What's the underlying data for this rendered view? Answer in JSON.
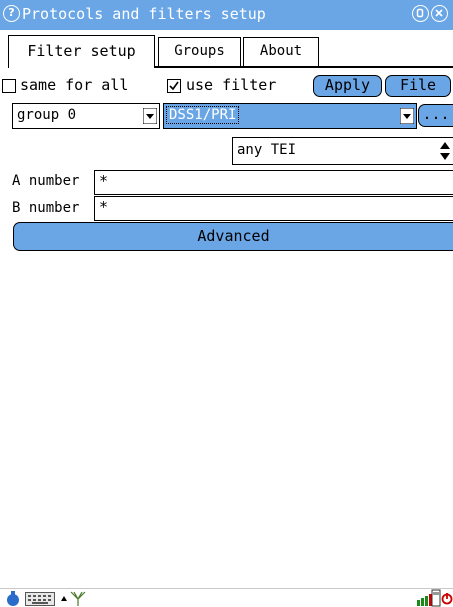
{
  "window": {
    "title": "Protocols and filters setup",
    "help_icon": "help-icon",
    "minimize_icon": "minimize-icon",
    "close_icon": "close-icon"
  },
  "tabs": [
    {
      "label": "Filter setup",
      "active": true
    },
    {
      "label": "Groups",
      "active": false
    },
    {
      "label": "About",
      "active": false
    }
  ],
  "options": {
    "same_for_all": {
      "label": "same for all",
      "checked": false
    },
    "use_filter": {
      "label": "use filter",
      "checked": true
    },
    "apply_label": "Apply",
    "file_label": "File"
  },
  "selectors": {
    "group": {
      "value": "group 0"
    },
    "protocol": {
      "value": "DSS1/PRI"
    },
    "more_label": "..."
  },
  "tei": {
    "value": "any TEI"
  },
  "fields": {
    "a_number": {
      "label": "A number",
      "value": "*"
    },
    "b_number": {
      "label": "B number",
      "value": "*"
    }
  },
  "advanced_label": "Advanced",
  "taskbar": {
    "icons": [
      "launcher-icon",
      "keyboard-icon",
      "up-arrow-icon",
      "antenna-icon",
      "signal-bars-icon",
      "sd-card-icon",
      "power-icon"
    ]
  },
  "colors": {
    "accent": "#6aa6e6",
    "background": "#ffffff",
    "text": "#000000",
    "signal": "#cc0000"
  }
}
